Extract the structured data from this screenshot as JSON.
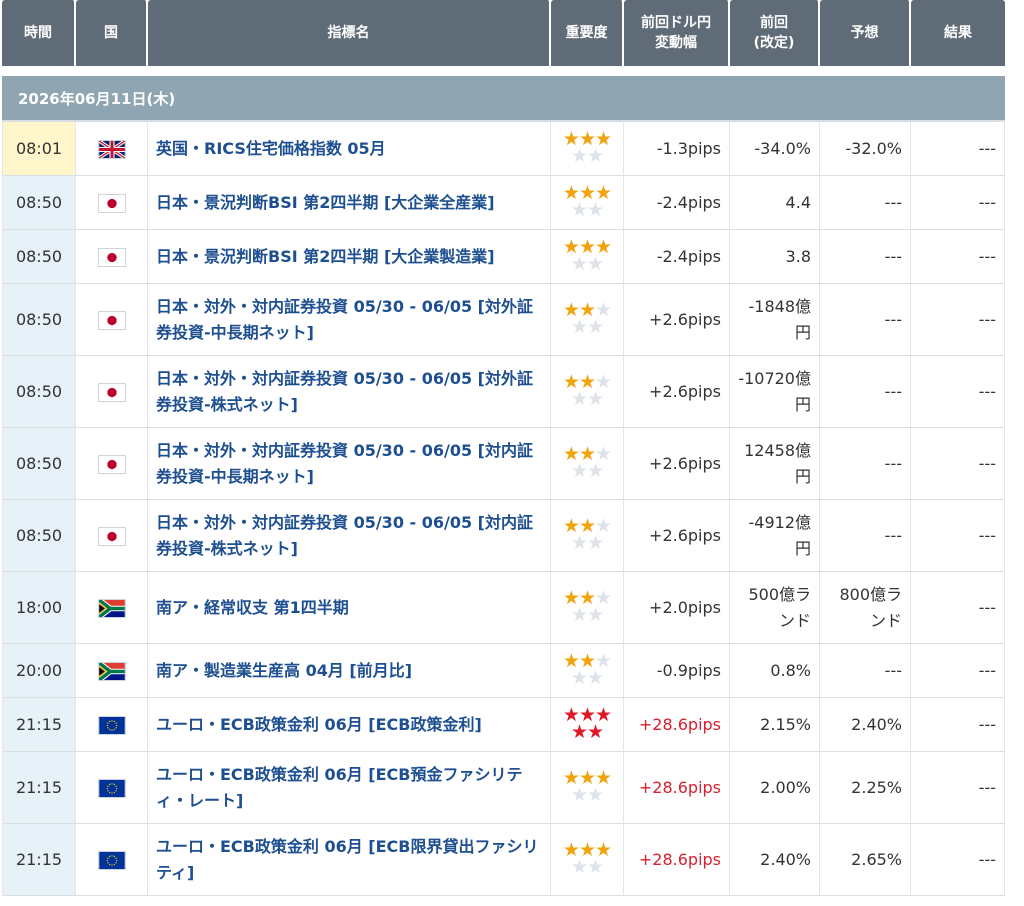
{
  "header": {
    "time": "時間",
    "country": "国",
    "indicator": "指標名",
    "importance": "重要度",
    "pips_line1": "前回ドル円",
    "pips_line2": "変動幅",
    "prev_line1": "前回",
    "prev_line2": "(改定)",
    "forecast": "予想",
    "result": "結果"
  },
  "date_label": "2026年06月11日(木)",
  "colors": {
    "header_bg": "#5f6c78",
    "date_bg": "#8fa6b2",
    "link": "#1d4f91",
    "star": "#f2a20c",
    "star_high": "#e0182a",
    "pips_high": "#d8202f"
  },
  "rows": [
    {
      "time": "08:01",
      "flag": "uk-flag-icon",
      "name": "英国・RICS住宅価格指数 05月",
      "stars": 3,
      "high": false,
      "pips": "-1.3pips",
      "prev": "-34.0%",
      "forecast": "-32.0%",
      "result": "---",
      "current": true
    },
    {
      "time": "08:50",
      "flag": "japan-flag-icon",
      "name": "日本・景況判断BSI 第2四半期 [大企業全産業]",
      "stars": 3,
      "high": false,
      "pips": "-2.4pips",
      "prev": "4.4",
      "forecast": "---",
      "result": "---"
    },
    {
      "time": "08:50",
      "flag": "japan-flag-icon",
      "name": "日本・景況判断BSI 第2四半期 [大企業製造業]",
      "stars": 3,
      "high": false,
      "pips": "-2.4pips",
      "prev": "3.8",
      "forecast": "---",
      "result": "---"
    },
    {
      "time": "08:50",
      "flag": "japan-flag-icon",
      "name": "日本・対外・対内証券投資 05/30 - 06/05 [対外証券投資-中長期ネット]",
      "stars": 2,
      "high": false,
      "pips": "+2.6pips",
      "prev": "-1848億円",
      "forecast": "---",
      "result": "---"
    },
    {
      "time": "08:50",
      "flag": "japan-flag-icon",
      "name": "日本・対外・対内証券投資 05/30 - 06/05 [対外証券投資-株式ネット]",
      "stars": 2,
      "high": false,
      "pips": "+2.6pips",
      "prev": "-10720億円",
      "forecast": "---",
      "result": "---"
    },
    {
      "time": "08:50",
      "flag": "japan-flag-icon",
      "name": "日本・対外・対内証券投資 05/30 - 06/05 [対内証券投資-中長期ネット]",
      "stars": 2,
      "high": false,
      "pips": "+2.6pips",
      "prev": "12458億円",
      "forecast": "---",
      "result": "---"
    },
    {
      "time": "08:50",
      "flag": "japan-flag-icon",
      "name": "日本・対外・対内証券投資 05/30 - 06/05 [対内証券投資-株式ネット]",
      "stars": 2,
      "high": false,
      "pips": "+2.6pips",
      "prev": "-4912億円",
      "forecast": "---",
      "result": "---"
    },
    {
      "time": "18:00",
      "flag": "south-africa-flag-icon",
      "name": "南ア・経常収支 第1四半期",
      "stars": 2,
      "high": false,
      "pips": "+2.0pips",
      "prev": "500億ランド",
      "forecast": "800億ランド",
      "result": "---"
    },
    {
      "time": "20:00",
      "flag": "south-africa-flag-icon",
      "name": "南ア・製造業生産高 04月 [前月比]",
      "stars": 2,
      "high": false,
      "pips": "-0.9pips",
      "prev": "0.8%",
      "forecast": "---",
      "result": "---"
    },
    {
      "time": "21:15",
      "flag": "eu-flag-icon",
      "name": "ユーロ・ECB政策金利 06月 [ECB政策金利]",
      "stars": 5,
      "high": true,
      "pips": "+28.6pips",
      "prev": "2.15%",
      "forecast": "2.40%",
      "result": "---"
    },
    {
      "time": "21:15",
      "flag": "eu-flag-icon",
      "name": "ユーロ・ECB政策金利 06月 [ECB預金ファシリティ・レート]",
      "stars": 3,
      "high": false,
      "pips": "+28.6pips",
      "pips_hot": true,
      "prev": "2.00%",
      "forecast": "2.25%",
      "result": "---"
    },
    {
      "time": "21:15",
      "flag": "eu-flag-icon",
      "name": "ユーロ・ECB政策金利 06月 [ECB限界貸出ファシリティ]",
      "stars": 3,
      "high": false,
      "pips": "+28.6pips",
      "pips_hot": true,
      "prev": "2.40%",
      "forecast": "2.65%",
      "result": "---"
    }
  ]
}
